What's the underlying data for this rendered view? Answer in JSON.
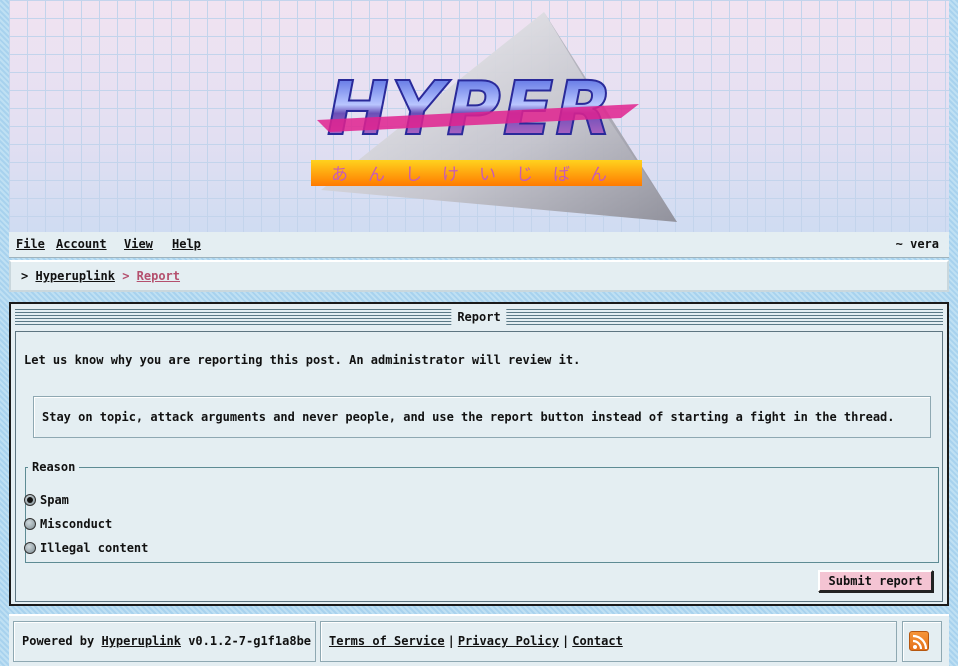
{
  "banner": {
    "logo_text": "HYPER",
    "logo_subtitle": "あんしけいじばん"
  },
  "menu": {
    "items": [
      {
        "label": "File"
      },
      {
        "label": "Account"
      },
      {
        "label": "View"
      },
      {
        "label": "Help"
      }
    ],
    "user": "~ vera"
  },
  "breadcrumb": {
    "home_sep": ">",
    "home": "Hyperuplink",
    "current_sep": ">",
    "current": "Report"
  },
  "panel": {
    "title": "Report",
    "intro": "Let us know why you are reporting this post. An administrator will review it.",
    "rules": "Stay on topic, attack arguments and never people, and use the report button instead of starting a fight in the thread.",
    "reason_legend": "Reason",
    "options": [
      {
        "label": "Spam",
        "selected": true
      },
      {
        "label": "Misconduct",
        "selected": false
      },
      {
        "label": "Illegal content",
        "selected": false
      }
    ],
    "submit_label": "Submit report"
  },
  "footer": {
    "powered_prefix": "Powered by",
    "powered_link": "Hyperuplink",
    "version": "v0.1.2-7-g1f1a8be",
    "links": [
      "Terms of Service",
      "Privacy Policy",
      "Contact"
    ],
    "separator": "|",
    "rss_icon": "rss-feed-icon"
  },
  "colors": {
    "accent_pink": "#f4c4d3",
    "breadcrumb_current": "#b4506e",
    "panel_bg": "#e4eef2",
    "rss_orange": "#f08a2a"
  }
}
